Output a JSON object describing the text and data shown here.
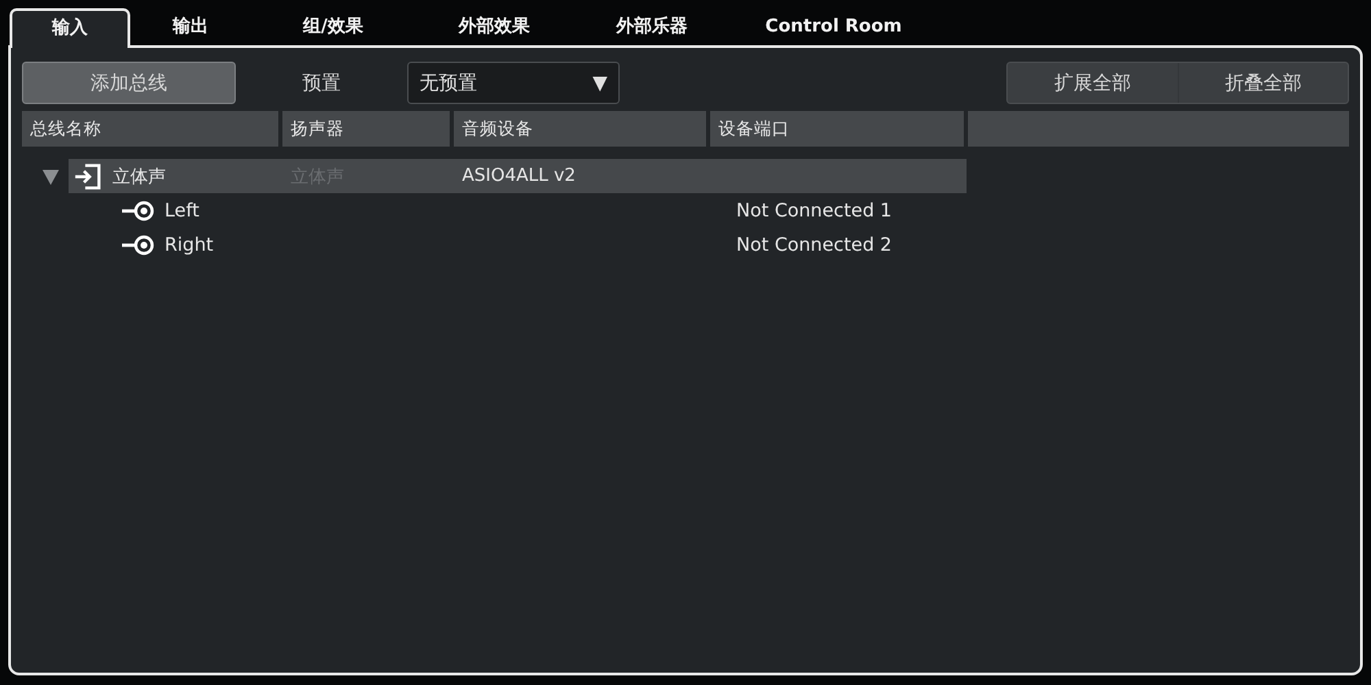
{
  "tabs": [
    {
      "label": "输入",
      "selected": true
    },
    {
      "label": "输出",
      "selected": false
    },
    {
      "label": "组/效果",
      "selected": false
    },
    {
      "label": "外部效果",
      "selected": false
    },
    {
      "label": "外部乐器",
      "selected": false
    },
    {
      "label": "Control Room",
      "selected": false
    }
  ],
  "toolbar": {
    "add_button": "添加总线",
    "preset_label": "预置",
    "preset_dropdown": {
      "value": "无预置",
      "arrow": "▼"
    },
    "expand_all": "扩展全部",
    "collapse_all": "折叠全部"
  },
  "table": {
    "columns": [
      "总线名称",
      "扬声器",
      "音频设备",
      "设备端口"
    ],
    "rows": [
      {
        "name": "立体声",
        "speaker": "立体声",
        "device": "ASIO4ALL v2",
        "expanded": true,
        "children": [
          {
            "name": "Left",
            "port": "Not Connected 1"
          },
          {
            "name": "Right",
            "port": "Not Connected 2"
          }
        ]
      }
    ]
  }
}
